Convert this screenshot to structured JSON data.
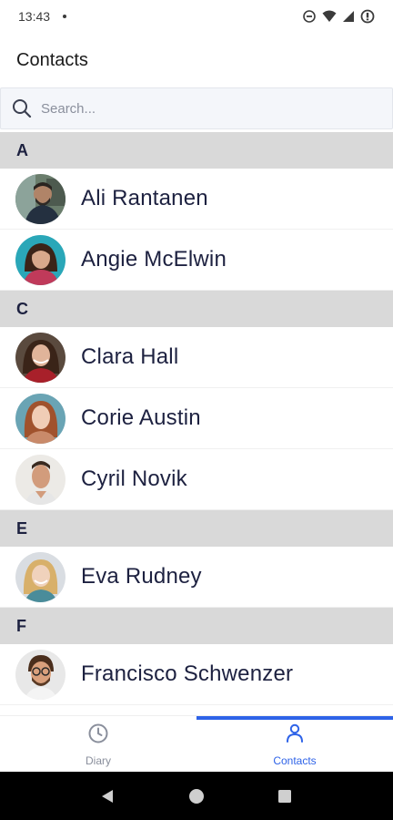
{
  "status_bar": {
    "time": "13:43",
    "icons": [
      "do-not-disturb-icon",
      "wifi-icon",
      "signal-icon",
      "battery-icon"
    ]
  },
  "header": {
    "title": "Contacts"
  },
  "search": {
    "placeholder": "Search..."
  },
  "sections": [
    {
      "letter": "A",
      "contacts": [
        {
          "name": "Ali Rantanen",
          "avatar": "photo-ali"
        },
        {
          "name": "Angie McElwin",
          "avatar": "photo-angie"
        }
      ]
    },
    {
      "letter": "C",
      "contacts": [
        {
          "name": "Clara Hall",
          "avatar": "photo-clara"
        },
        {
          "name": "Corie Austin",
          "avatar": "photo-corie"
        },
        {
          "name": "Cyril Novik",
          "avatar": "photo-cyril"
        }
      ]
    },
    {
      "letter": "E",
      "contacts": [
        {
          "name": "Eva Rudney",
          "avatar": "photo-eva"
        }
      ]
    },
    {
      "letter": "F",
      "contacts": [
        {
          "name": "Francisco Schwenzer",
          "avatar": "photo-francisco"
        }
      ]
    }
  ],
  "bottom_nav": {
    "tabs": [
      {
        "label": "Diary",
        "icon": "clock-icon",
        "active": false
      },
      {
        "label": "Contacts",
        "icon": "person-icon",
        "active": true
      }
    ]
  },
  "colors": {
    "accent": "#2e63e8",
    "section_bg": "#d9d9d9",
    "text": "#1d2140",
    "inactive": "#8a8f9c"
  },
  "system_nav": {
    "icons": [
      "back-icon",
      "home-icon",
      "recents-icon"
    ]
  }
}
